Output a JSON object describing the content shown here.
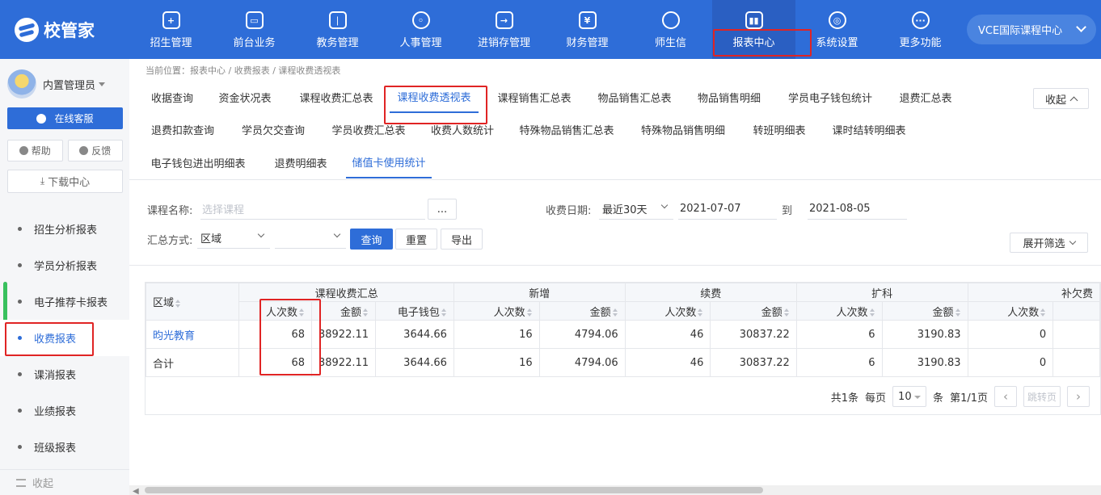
{
  "brand": {
    "logo_text": "校管家"
  },
  "nav": [
    {
      "label": "招生管理",
      "icon": "user-plus-icon",
      "glyph": "+"
    },
    {
      "label": "前台业务",
      "icon": "monitor-icon",
      "glyph": "▭"
    },
    {
      "label": "教务管理",
      "icon": "book-icon",
      "glyph": "❘"
    },
    {
      "label": "人事管理",
      "icon": "person-icon",
      "glyph": "◦"
    },
    {
      "label": "进销存管理",
      "icon": "inventory-icon",
      "glyph": "→"
    },
    {
      "label": "财务管理",
      "icon": "yuan-icon",
      "glyph": "¥"
    },
    {
      "label": "师生信",
      "icon": "chat-icon",
      "glyph": ""
    },
    {
      "label": "报表中心",
      "icon": "bar-chart-icon",
      "glyph": "▮▮"
    },
    {
      "label": "系统设置",
      "icon": "settings-icon",
      "glyph": "◎"
    },
    {
      "label": "更多功能",
      "icon": "more-icon",
      "glyph": "···"
    }
  ],
  "org_selector": {
    "label": "VCE国际课程中心"
  },
  "user": {
    "name": "内置管理员"
  },
  "sidebar": {
    "service_label": "在线客服",
    "help_label": "帮助",
    "feedback_label": "反馈",
    "download_label": "下载中心",
    "menu": [
      "招生分析报表",
      "学员分析报表",
      "电子推荐卡报表",
      "收费报表",
      "课消报表",
      "业绩报表",
      "班级报表"
    ],
    "active_index": 3,
    "collapse_label": "收起"
  },
  "breadcrumb": "当前位置：报表中心 / 收费报表 / 课程收费透视表",
  "report_tabs": {
    "row1": [
      "收据查询",
      "资金状况表",
      "课程收费汇总表",
      "课程收费透视表",
      "课程销售汇总表",
      "物品销售汇总表",
      "物品销售明细",
      "学员电子钱包统计",
      "退费汇总表"
    ],
    "row2": [
      "退费扣款查询",
      "学员欠交查询",
      "学员收费汇总表",
      "收费人数统计",
      "特殊物品销售汇总表",
      "特殊物品销售明细",
      "转班明细表",
      "课时结转明细表"
    ],
    "row3": [
      "电子钱包进出明细表",
      "退费明细表",
      "储值卡使用统计"
    ],
    "collapse_label": "收起"
  },
  "filters": {
    "course_label": "课程名称:",
    "course_placeholder": "选择课程",
    "dots_label": "...",
    "date_label": "收费日期:",
    "date_range": "最近30天",
    "date_from": "2021-07-07",
    "to_label": "到",
    "date_to": "2021-08-05",
    "group_label": "汇总方式:",
    "group_value": "区域",
    "group_value2": "",
    "query_label": "查询",
    "reset_label": "重置",
    "export_label": "导出",
    "expand_label": "展开筛选"
  },
  "table": {
    "region_header": "区域",
    "group_headers": [
      "课程收费汇总",
      "新增",
      "续费",
      "扩科",
      "补欠费"
    ],
    "sub_headers": [
      "人次数",
      "金额",
      "电子钱包",
      "人次数",
      "金额",
      "人次数",
      "金额",
      "人次数",
      "金额",
      "人次数"
    ],
    "rows": [
      {
        "region": "昀光教育",
        "values": [
          "68",
          "38922.11",
          "3644.66",
          "16",
          "4794.06",
          "46",
          "30837.22",
          "6",
          "3190.83",
          "0"
        ]
      },
      {
        "region": "合计",
        "values": [
          "68",
          "38922.11",
          "3644.66",
          "16",
          "4794.06",
          "46",
          "30837.22",
          "6",
          "3190.83",
          "0"
        ]
      }
    ]
  },
  "pager": {
    "total": "共1条",
    "per_page_label": "每页",
    "per_page": "10",
    "unit": "条",
    "page_info": "第1/1页",
    "prev": "‹",
    "jump": "跳转页",
    "next": "›"
  },
  "colors": {
    "primary": "#2e6dd8",
    "highlight": "#e02424"
  }
}
